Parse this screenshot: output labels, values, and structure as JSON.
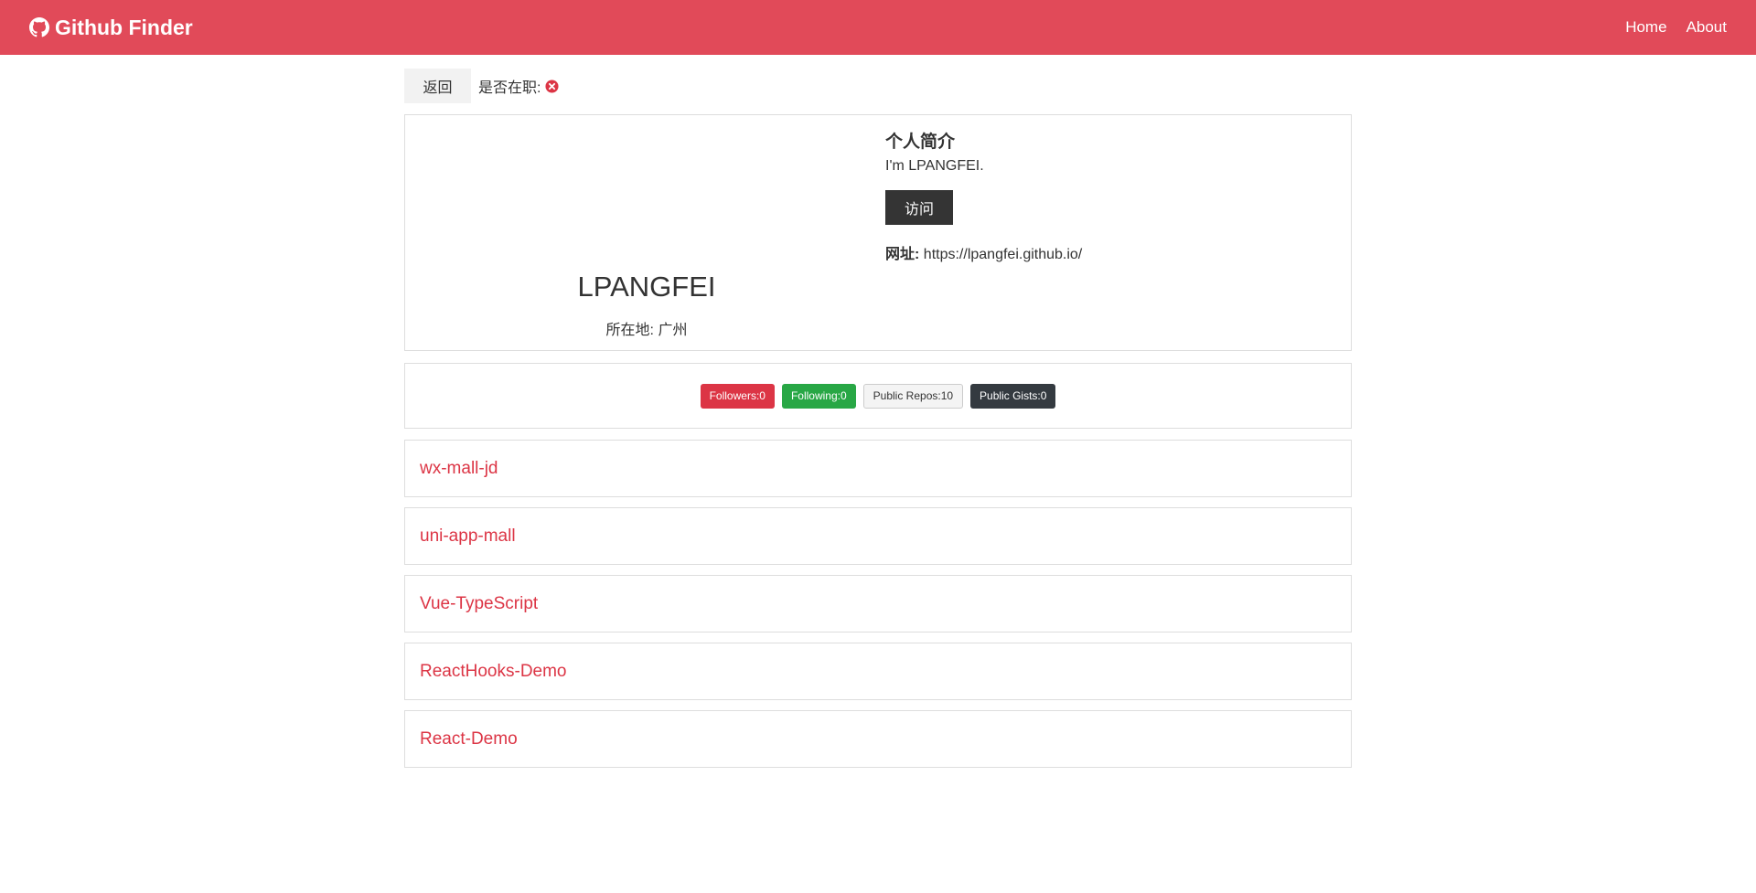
{
  "navbar": {
    "brand": "Github Finder",
    "links": [
      "Home",
      "About"
    ]
  },
  "topbar": {
    "back_label": "返回",
    "hireable_label": "是否在职:",
    "hireable_icon": "x-circle-icon",
    "hireable_color": "#dc3545"
  },
  "profile": {
    "name": "LPANGFEI",
    "location": "所在地: 广州",
    "bio_title": "个人简介",
    "bio": "I'm LPANGFEI.",
    "visit_label": "访问",
    "website_label": "网址:",
    "website": "https://lpangfei.github.io/"
  },
  "badges": {
    "followers": "Followers:0",
    "following": "Following:0",
    "public_repos": "Public Repos:10",
    "public_gists": "Public Gists:0"
  },
  "repos": [
    "wx-mall-jd",
    "uni-app-mall",
    "Vue-TypeScript",
    "ReactHooks-Demo",
    "React-Demo"
  ],
  "colors": {
    "navbar": "#e14a59",
    "accent_red": "#dc3545",
    "green": "#28a745",
    "dark": "#343a40"
  }
}
